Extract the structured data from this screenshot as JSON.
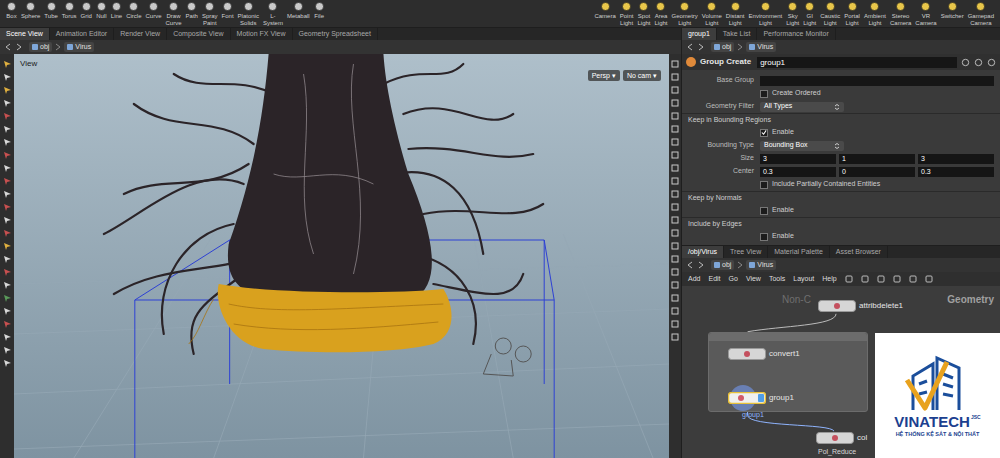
{
  "shelf": {
    "create": [
      "Box",
      "Sphere",
      "Tube",
      "Torus",
      "Grid",
      "Null",
      "Line",
      "Circle",
      "Curve",
      "Draw Curve",
      "Path",
      "Spray Paint",
      "Font",
      "Platonic Solids",
      "L-System",
      "Metaball",
      "File"
    ],
    "lights": [
      "Camera",
      "Point Light",
      "Spot Light",
      "Area Light",
      "Geometry Light",
      "Volume Light",
      "Distant Light",
      "Environment Light",
      "Sky Light",
      "GI Light",
      "Caustic Light",
      "Portal Light",
      "Ambient Light",
      "Stereo Camera",
      "VR Camera",
      "Switcher",
      "Gamepad Camera"
    ]
  },
  "scene_tabs": [
    {
      "label": "Scene View",
      "selected": true
    },
    {
      "label": "Animation Editor",
      "selected": false
    },
    {
      "label": "Render View",
      "selected": false
    },
    {
      "label": "Composite View",
      "selected": false
    },
    {
      "label": "Motion FX View",
      "selected": false
    },
    {
      "label": "Geometry Spreadsheet",
      "selected": false
    }
  ],
  "param_tabs": [
    {
      "label": "group1",
      "selected": true
    },
    {
      "label": "Take List",
      "selected": false
    },
    {
      "label": "Performance Monitor",
      "selected": false
    }
  ],
  "scene_path": [
    "obj",
    "Virus"
  ],
  "param_path": [
    "obj",
    "Virus"
  ],
  "viewport": {
    "label": "View",
    "projection": "Persp ▾",
    "camera": "No cam ▾"
  },
  "params": {
    "type": "Group Create",
    "name": "group1",
    "rows": [
      {
        "kind": "field",
        "label": "Base Group",
        "value": ""
      },
      {
        "kind": "checkbox",
        "label": "Create Ordered",
        "checked": false
      },
      {
        "kind": "dropdown",
        "label": "Geometry Filter",
        "value": "All Types"
      },
      {
        "kind": "section",
        "label": "Keep in Bounding Regions"
      },
      {
        "kind": "checkbox",
        "label": "Enable",
        "checked": true
      },
      {
        "kind": "dropdown",
        "label": "Bounding Type",
        "value": "Bounding Box"
      },
      {
        "kind": "vector",
        "label": "Size",
        "values": [
          "3",
          "1",
          "3"
        ]
      },
      {
        "kind": "vector",
        "label": "Center",
        "values": [
          "0.3",
          "0",
          "0.3"
        ]
      },
      {
        "kind": "checkbox",
        "label": "Include Partially Contained Entities",
        "checked": false
      },
      {
        "kind": "section",
        "label": "Keep by Normals"
      },
      {
        "kind": "checkbox",
        "label": "Enable",
        "checked": false
      },
      {
        "kind": "section",
        "label": "Include by Edges"
      },
      {
        "kind": "checkbox",
        "label": "Enable",
        "checked": false
      }
    ]
  },
  "network": {
    "tabs": [
      {
        "label": "/obj/Virus",
        "selected": true
      },
      {
        "label": "Tree View",
        "selected": false
      },
      {
        "label": "Material Palette",
        "selected": false
      },
      {
        "label": "Asset Browser",
        "selected": false
      }
    ],
    "path": [
      "obj",
      "Virus"
    ],
    "menu": [
      "Add",
      "Edit",
      "Go",
      "View",
      "Tools",
      "Layout",
      "Help"
    ],
    "watermark": "Non-C",
    "context": "Geometry",
    "nodes": [
      {
        "name": "attribdelete1",
        "selected": false
      },
      {
        "name": "convert1",
        "selected": false
      },
      {
        "name": "group1",
        "selected": true
      },
      {
        "name": "col",
        "selected": false
      }
    ],
    "wire_label": "group1",
    "bottom_label": "Pol_Reduce"
  },
  "logo": {
    "name": "VINATECH",
    "suffix": "JSC",
    "tagline": "HỆ THỐNG KỆ SẮT & NỘI THẤT"
  }
}
